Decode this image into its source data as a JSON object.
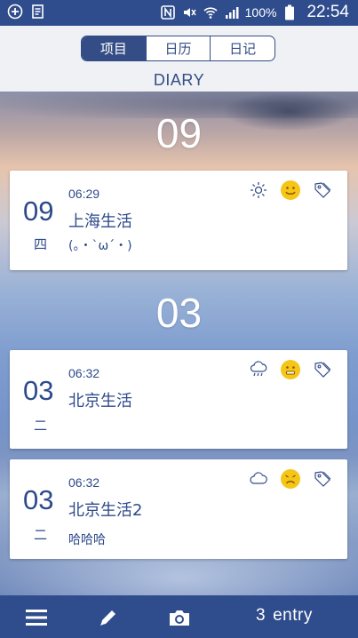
{
  "status_bar": {
    "battery": "100%",
    "time": "22:54"
  },
  "header": {
    "tabs": [
      {
        "label": "项目",
        "active": true
      },
      {
        "label": "日历",
        "active": false
      },
      {
        "label": "日记",
        "active": false
      }
    ],
    "title": "DIARY"
  },
  "sections": [
    {
      "month": "09",
      "entries": [
        {
          "day": "09",
          "weekday": "四",
          "time": "06:29",
          "title": "上海生活",
          "body": "(。・`ω´・)",
          "weather_icon": "sun-icon",
          "mood_icon": "smile-face-icon",
          "tag_icon": "tag-icon"
        }
      ]
    },
    {
      "month": "03",
      "entries": [
        {
          "day": "03",
          "weekday": "二",
          "time": "06:32",
          "title": "北京生活",
          "body": "",
          "weather_icon": "rain-cloud-icon",
          "mood_icon": "neutral-face-icon",
          "tag_icon": "tag-icon"
        },
        {
          "day": "03",
          "weekday": "二",
          "time": "06:32",
          "title": "北京生活2",
          "body": "哈哈哈",
          "weather_icon": "cloud-icon",
          "mood_icon": "frown-face-icon",
          "tag_icon": "tag-icon"
        }
      ]
    }
  ],
  "bottom_bar": {
    "entry_count": "3",
    "entry_label": "entry",
    "icons": [
      "menu-icon",
      "pencil-icon",
      "camera-icon"
    ]
  },
  "colors": {
    "primary": "#2f4d8c",
    "text_blue": "#2d4a8a",
    "mood_yellow": "#f5c518"
  }
}
